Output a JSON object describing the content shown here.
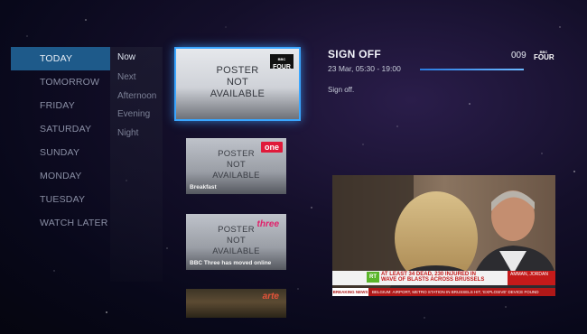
{
  "days": [
    "TODAY",
    "TOMORROW",
    "FRIDAY",
    "SATURDAY",
    "SUNDAY",
    "MONDAY",
    "TUESDAY",
    "WATCH LATER"
  ],
  "slots": [
    "Now",
    "Next",
    "Afternoon",
    "Evening",
    "Night"
  ],
  "posters": {
    "selected": {
      "line1": "POSTER",
      "line2": "NOT",
      "line3": "AVAILABLE",
      "logo_small": "BBC",
      "logo": "FOUR"
    },
    "breakfast": {
      "line1": "POSTER",
      "line2": "NOT",
      "line3": "AVAILABLE",
      "title": "Breakfast",
      "logo": "one"
    },
    "three": {
      "line1": "POSTER",
      "line2": "NOT",
      "line3": "AVAILABLE",
      "title": "BBC Three has moved online",
      "logo": "three"
    },
    "arte": {
      "logo": "arte"
    }
  },
  "program": {
    "title": "SIGN OFF",
    "time": "23 Mar, 05:30 - 19:00",
    "progress": 1.0,
    "channel_number": "009",
    "channel_logo_small": "BBC",
    "channel_logo": "FOUR",
    "description": "Sign off."
  },
  "video": {
    "rt_badge": "RT",
    "headline": "AT LEAST 34 DEAD, 230 INJURED IN WAVE OF BLASTS ACROSS BRUSSELS",
    "location": "AMMAN, JORDAN",
    "breaking": "BREAKING NEWS",
    "crawl": "BELGIUM: AIRPORT, METRO STATION IN BRUSSELS HIT, 'EXPLOSIVE' DEVICE FOUND"
  },
  "colors": {
    "accent": "#1e5a8a",
    "highlight": "#3aa6ff"
  }
}
